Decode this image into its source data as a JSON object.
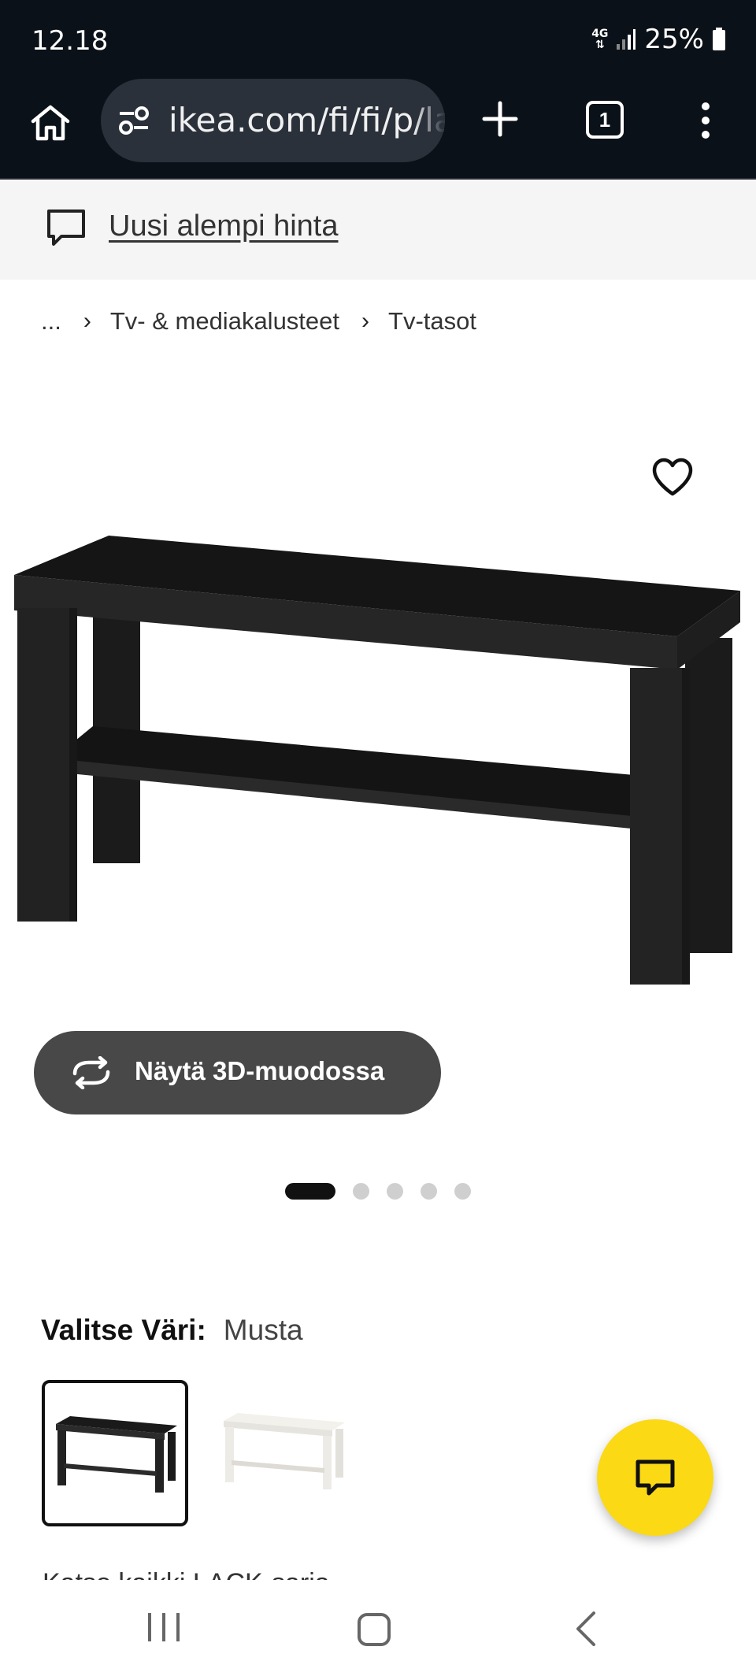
{
  "status_bar": {
    "time": "12.18",
    "network": "4G",
    "battery": "25%"
  },
  "browser": {
    "url": "ikea.com/fi/fi/p/lack",
    "tab_count": "1"
  },
  "banner": {
    "link_text": "Uusi alempi hinta"
  },
  "breadcrumb": {
    "items": [
      "...",
      "Tv- & mediakalusteet",
      "Tv-tasot"
    ]
  },
  "product": {
    "view_3d_label": "Näytä 3D-muodossa",
    "image_count": 5,
    "active_image": 1
  },
  "color_select": {
    "label": "Valitse Väri:",
    "value": "Musta",
    "options": [
      "Musta",
      "Valkoinen"
    ]
  },
  "series_link": "Katso kaikki LACK-sarja",
  "colors": {
    "top_bar": "#0b1119",
    "accent_fab": "#fbd914",
    "button_3d": "#484848"
  }
}
